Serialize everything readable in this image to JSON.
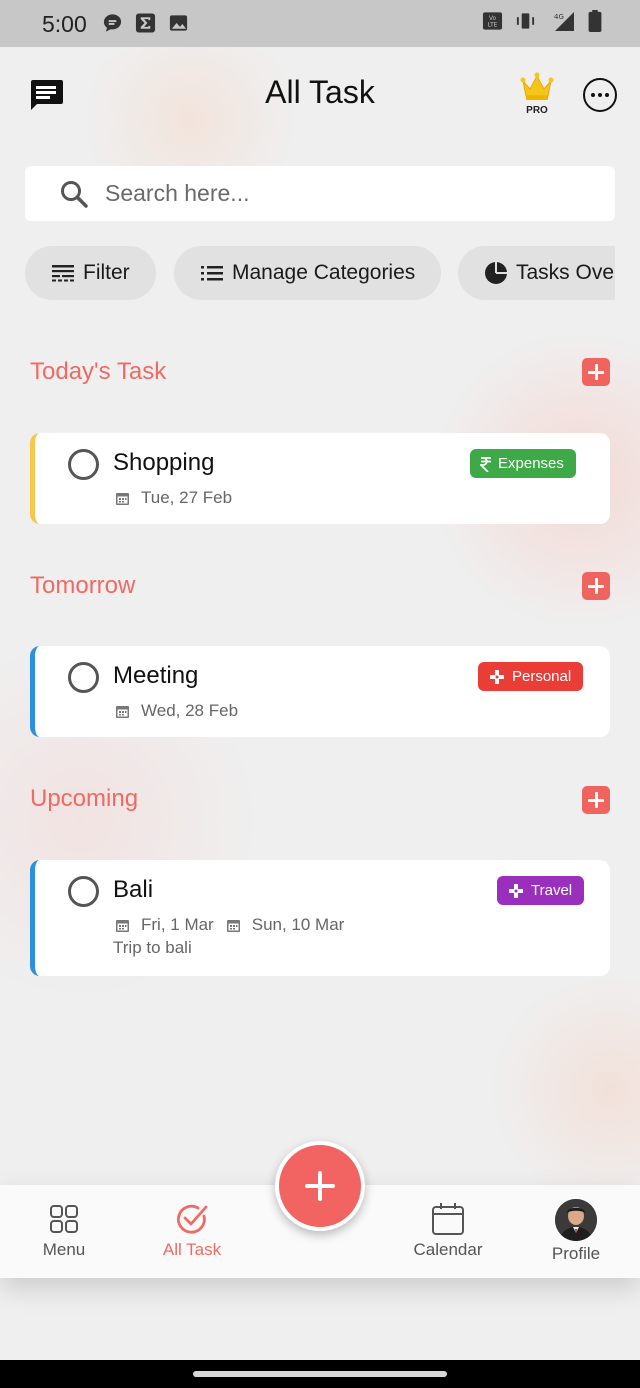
{
  "status_bar": {
    "time": "5:00",
    "left_icons": [
      "chat-bubble-icon",
      "sigma-icon",
      "image-icon"
    ],
    "right_icons": [
      "volte-icon",
      "vibrate-icon",
      "signal-4g-icon",
      "battery-icon"
    ]
  },
  "header": {
    "title": "All Task",
    "pro_label": "PRO",
    "left_icon": "chat-icon",
    "right_icon": "more-icon"
  },
  "search": {
    "placeholder": "Search here..."
  },
  "chips": [
    {
      "label": "Filter",
      "icon": "filter-icon"
    },
    {
      "label": "Manage Categories",
      "icon": "list-icon"
    },
    {
      "label": "Tasks Ove",
      "icon": "pie-chart-icon"
    }
  ],
  "sections": [
    {
      "title": "Today's Task",
      "tasks": [
        {
          "title": "Shopping",
          "dates": [
            "Tue, 27 Feb"
          ],
          "note": "",
          "tag": "Expenses",
          "tag_color": "#3daa47",
          "accent": "#f5c84c"
        }
      ]
    },
    {
      "title": "Tomorrow",
      "tasks": [
        {
          "title": "Meeting",
          "dates": [
            "Wed, 28 Feb"
          ],
          "note": "",
          "tag": "Personal",
          "tag_color": "#ea3d35",
          "accent": "#2d8fe0"
        }
      ]
    },
    {
      "title": "Upcoming",
      "tasks": [
        {
          "title": "Bali",
          "dates": [
            "Fri, 1 Mar",
            "Sun, 10 Mar"
          ],
          "note": "Trip to bali",
          "tag": "Travel",
          "tag_color": "#9b2fbd",
          "accent": "#2d8fe0"
        }
      ]
    }
  ],
  "nav": {
    "items": [
      {
        "label": "Menu",
        "icon": "grid-icon"
      },
      {
        "label": "All Task",
        "icon": "check-circle-icon",
        "active": true
      },
      {
        "label": "Calendar",
        "icon": "calendar-icon"
      },
      {
        "label": "Profile",
        "icon": "avatar"
      }
    ]
  },
  "colors": {
    "accent": "#f06a63",
    "background": "#efefef"
  }
}
